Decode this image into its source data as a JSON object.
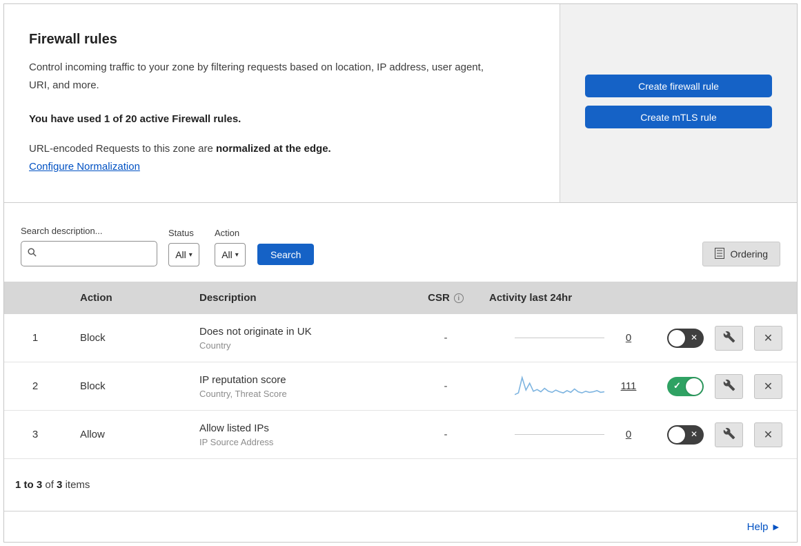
{
  "header": {
    "title": "Firewall rules",
    "description": "Control incoming traffic to your zone by filtering requests based on location, IP address, user agent, URI, and more.",
    "usage": "You have used 1 of 20 active Firewall rules.",
    "normalization_prefix": "URL-encoded Requests to this zone are",
    "normalization_bold": "normalized at the edge.",
    "normalization_link": "Configure Normalization",
    "buttons": [
      {
        "label": "Create firewall rule"
      },
      {
        "label": "Create mTLS rule"
      }
    ]
  },
  "filters": {
    "search_label": "Search description...",
    "status_label": "Status",
    "status_value": "All",
    "action_label": "Action",
    "action_value": "All",
    "search_button": "Search",
    "ordering_button": "Ordering"
  },
  "table": {
    "columns": {
      "action": "Action",
      "description": "Description",
      "csr": "CSR",
      "csr_info": "i",
      "activity": "Activity last 24hr"
    },
    "rows": [
      {
        "index": "1",
        "action": "Block",
        "description": "Does not originate in UK",
        "criteria": "Country",
        "csr": "-",
        "activity_count": "0",
        "enabled": false,
        "sparkline": []
      },
      {
        "index": "2",
        "action": "Block",
        "description": "IP reputation score",
        "criteria": "Country, Threat Score",
        "csr": "-",
        "activity_count": "111",
        "enabled": true,
        "sparkline": [
          4,
          7,
          34,
          12,
          24,
          10,
          13,
          9,
          15,
          10,
          8,
          12,
          9,
          7,
          11,
          8,
          14,
          9,
          7,
          10,
          8,
          9,
          11,
          8,
          9
        ]
      },
      {
        "index": "3",
        "action": "Allow",
        "description": "Allow listed IPs",
        "criteria": "IP Source Address",
        "csr": "-",
        "activity_count": "0",
        "enabled": false,
        "sparkline": []
      }
    ],
    "footer": {
      "range": "1 to 3",
      "of": "of",
      "total": "3",
      "items": "items"
    }
  },
  "help_label": "Help",
  "icons": {
    "check": "✓",
    "cross": "✕",
    "caret": "▾",
    "help_arrow": "▶"
  },
  "colors": {
    "primary_blue": "#1562c6",
    "link_blue": "#0051c3",
    "toggle_on_green": "#2fa263",
    "toggle_off_dark": "#3f3f3f",
    "table_header_bg": "#d7d7d7",
    "panel_gray": "#f1f1f1",
    "sparkline_blue": "#7db4e0"
  }
}
